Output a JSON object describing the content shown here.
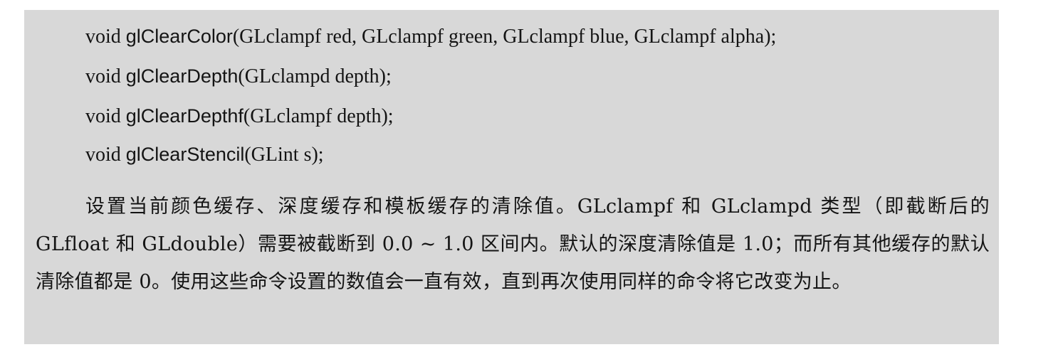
{
  "code_lines": [
    {
      "return_type": "void",
      "fn_name": "glClearColor",
      "params": "(GLclampf red, GLclampf green, GLclampf blue, GLclampf alpha);"
    },
    {
      "return_type": "void",
      "fn_name": "glClearDepth",
      "params": "(GLclampd depth);"
    },
    {
      "return_type": "void",
      "fn_name": "glClearDepthf",
      "params": "(GLclampf depth);"
    },
    {
      "return_type": "void",
      "fn_name": "glClearStencil",
      "params": "(GLint s);"
    }
  ],
  "description": "设置当前颜色缓存、深度缓存和模板缓存的清除值。GLclampf 和 GLclampd 类型（即截断后的 GLfloat 和 GLdouble）需要被截断到 0.0 ~ 1.0 区间内。默认的深度清除值是 1.0；而所有其他缓存的默认清除值都是 0。使用这些命令设置的数值会一直有效，直到再次使用同样的命令将它改变为止。"
}
